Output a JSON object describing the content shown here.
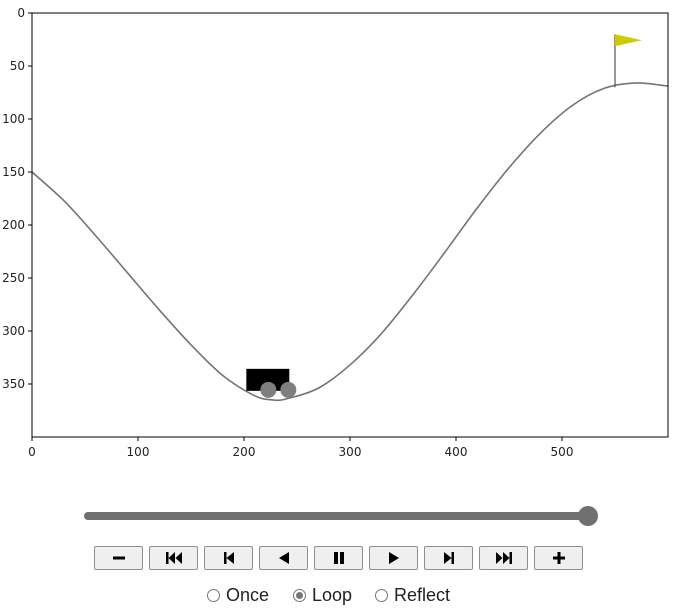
{
  "chart_data": {
    "type": "line",
    "title": "",
    "xlabel": "",
    "ylabel": "",
    "xlim": [
      0,
      600
    ],
    "ylim": [
      400,
      0
    ],
    "x_ticks": [
      "0",
      "100",
      "200",
      "300",
      "400",
      "500"
    ],
    "y_ticks": [
      "0",
      "50",
      "100",
      "150",
      "200",
      "250",
      "300",
      "350"
    ],
    "y_tick_values": [
      0,
      50,
      100,
      150,
      200,
      250,
      300,
      350
    ],
    "x_tick_values": [
      0,
      100,
      200,
      300,
      400,
      500
    ],
    "grid": false,
    "series": [
      {
        "x": [
          0,
          30,
          60,
          90,
          120,
          150,
          180,
          210,
          227,
          240,
          270,
          300,
          330,
          360,
          390,
          420,
          450,
          480,
          510,
          540,
          570,
          600
        ],
        "y": [
          150,
          177,
          210,
          245,
          280,
          313,
          342,
          361,
          365,
          364,
          354,
          332,
          302,
          265,
          225,
          184,
          146,
          113,
          87,
          71,
          66,
          69
        ]
      }
    ],
    "cart": {
      "x": 222,
      "y": 364,
      "color": "#000000",
      "wheel_color": "#7f7f7f"
    },
    "flag": {
      "x": 550,
      "pole_bottom_y": 70,
      "pole_top_y": 20,
      "color": "#cccc00"
    }
  },
  "player": {
    "slider_value": 1.0,
    "buttons": [
      {
        "name": "slower-button",
        "icon": "minus-icon"
      },
      {
        "name": "first-frame-button",
        "icon": "fast-backward-icon"
      },
      {
        "name": "previous-frame-button",
        "icon": "step-backward-icon"
      },
      {
        "name": "play-reverse-button",
        "icon": "play-reverse-icon"
      },
      {
        "name": "pause-button",
        "icon": "pause-icon"
      },
      {
        "name": "play-button",
        "icon": "play-icon"
      },
      {
        "name": "next-frame-button",
        "icon": "step-forward-icon"
      },
      {
        "name": "last-frame-button",
        "icon": "fast-forward-icon"
      },
      {
        "name": "faster-button",
        "icon": "plus-icon"
      }
    ],
    "modes": [
      {
        "label": "Once",
        "checked": false
      },
      {
        "label": "Loop",
        "checked": true
      },
      {
        "label": "Reflect",
        "checked": false
      }
    ]
  }
}
